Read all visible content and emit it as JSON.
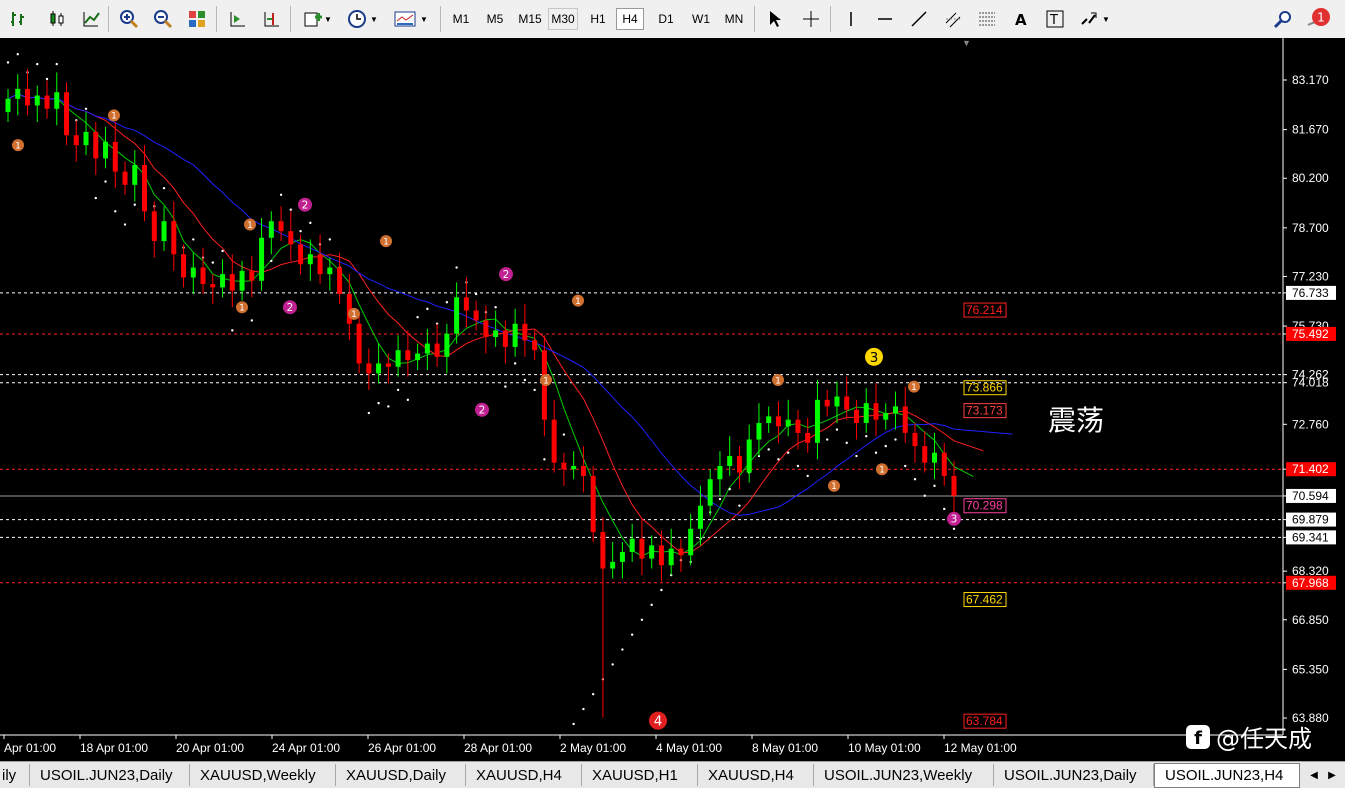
{
  "toolbar": {
    "timeframes": [
      "M1",
      "M5",
      "M15",
      "M30",
      "H1",
      "H4",
      "D1",
      "W1",
      "MN"
    ],
    "active_timeframe": "H4",
    "notification_count": "1"
  },
  "chart": {
    "price_labels": [
      "83.170",
      "81.670",
      "80.200",
      "78.700",
      "77.230",
      "75.730",
      "74.262",
      "74.018",
      "72.760",
      "71.402",
      "70.594",
      "69.879",
      "69.341",
      "68.320",
      "67.968",
      "66.850",
      "65.350",
      "63.880",
      "76.733",
      "75.492"
    ],
    "date_labels": [
      "Apr 01:00",
      "18 Apr 01:00",
      "20 Apr 01:00",
      "24 Apr 01:00",
      "26 Apr 01:00",
      "28 Apr 01:00",
      "2 May 01:00",
      "4 May 01:00",
      "8 May 01:00",
      "10 May 01:00",
      "12 May 01:00"
    ],
    "level_labels": [
      "76.214",
      "73.866",
      "73.173",
      "70.298",
      "67.462",
      "63.784"
    ],
    "annotation": "震荡",
    "watermark": "@任天成"
  },
  "tabs": {
    "items": [
      "ily",
      "USOIL.JUN23,Daily",
      "XAUUSD,Weekly",
      "XAUUSD,Daily",
      "XAUUSD,H4",
      "XAUUSD,H1",
      "XAUUSD,H4",
      "USOIL.JUN23,Weekly",
      "USOIL.JUN23,Daily",
      "USOIL.JUN23,H4"
    ],
    "active": "USOIL.JUN23,H4"
  },
  "colors": {
    "background": "#000000",
    "bull_candle": "#00ff00",
    "bear_candle": "#ff0000",
    "ma_fast": "#00cc00",
    "ma_mid": "#ff2020",
    "ma_slow": "#2020ff"
  }
}
